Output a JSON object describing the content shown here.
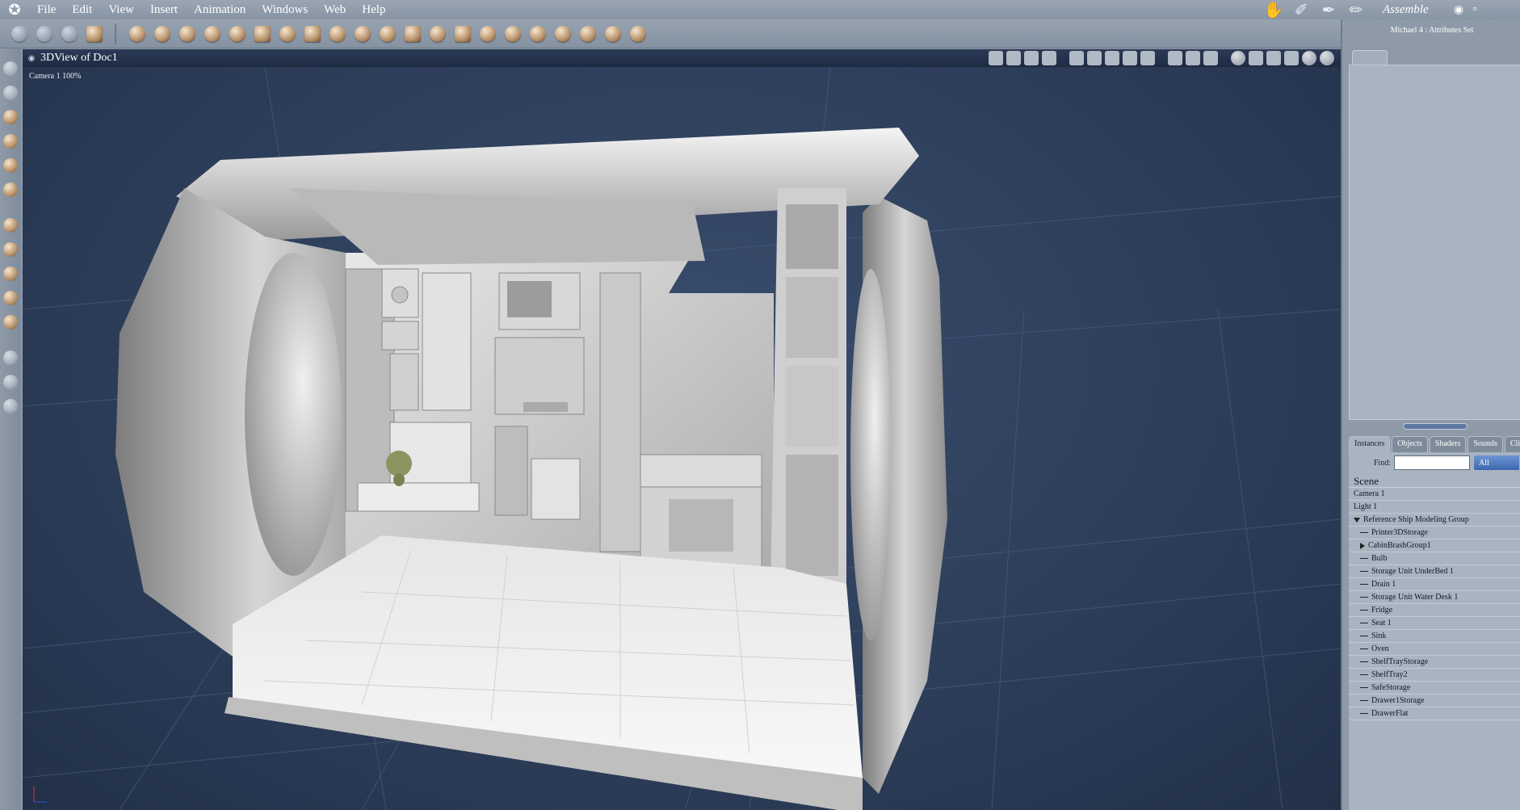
{
  "menu": {
    "items": [
      "File",
      "Edit",
      "View",
      "Insert",
      "Animation",
      "Windows",
      "Web",
      "Help"
    ]
  },
  "rooms": {
    "current": "Assemble",
    "icons": [
      "hand-room-icon",
      "brush-room-icon",
      "pen-room-icon",
      "pencil-room-icon",
      "ruler-room-icon"
    ]
  },
  "view": {
    "window_title": "3DView of Doc1",
    "camera_label": "Camera 1  100%"
  },
  "attributes": {
    "title": "Michael 4 : Attributes Set"
  },
  "browser": {
    "tabs": [
      "Instances",
      "Objects",
      "Shaders",
      "Sounds",
      "Clips"
    ],
    "active_tab": "Instances",
    "find_label": "Find:",
    "find_value": "",
    "filter_value": "All",
    "scene_label": "Scene",
    "items": [
      {
        "label": "Camera 1",
        "depth": 0,
        "node": "none"
      },
      {
        "label": "Light 1",
        "depth": 0,
        "node": "none"
      },
      {
        "label": "Reference Ship Modeling Group",
        "depth": 0,
        "node": "open"
      },
      {
        "label": "Printer3DStorage",
        "depth": 1,
        "node": "line"
      },
      {
        "label": "CabinBrashGroup1",
        "depth": 1,
        "node": "closed"
      },
      {
        "label": "Bulb",
        "depth": 1,
        "node": "line"
      },
      {
        "label": "Storage Unit UnderBed 1",
        "depth": 1,
        "node": "line"
      },
      {
        "label": "Drain 1",
        "depth": 1,
        "node": "line"
      },
      {
        "label": "Storage Unit Water Desk 1",
        "depth": 1,
        "node": "line"
      },
      {
        "label": "Fridge",
        "depth": 1,
        "node": "line"
      },
      {
        "label": "Seat 1",
        "depth": 1,
        "node": "line"
      },
      {
        "label": "Sink",
        "depth": 1,
        "node": "line"
      },
      {
        "label": "Oven",
        "depth": 1,
        "node": "line"
      },
      {
        "label": "ShelfTrayStorage",
        "depth": 1,
        "node": "line"
      },
      {
        "label": "ShelfTray2",
        "depth": 1,
        "node": "line"
      },
      {
        "label": "SafeStorage",
        "depth": 1,
        "node": "line"
      },
      {
        "label": "Drawer1Storage",
        "depth": 1,
        "node": "line"
      },
      {
        "label": "DrawerFlat",
        "depth": 1,
        "node": "line"
      }
    ]
  },
  "colors": {
    "chrome": "#8e9aa8",
    "title_bar": "#1d2a42",
    "viewport_bg": "#2a3a55",
    "accent_select": "#3d68ad"
  }
}
